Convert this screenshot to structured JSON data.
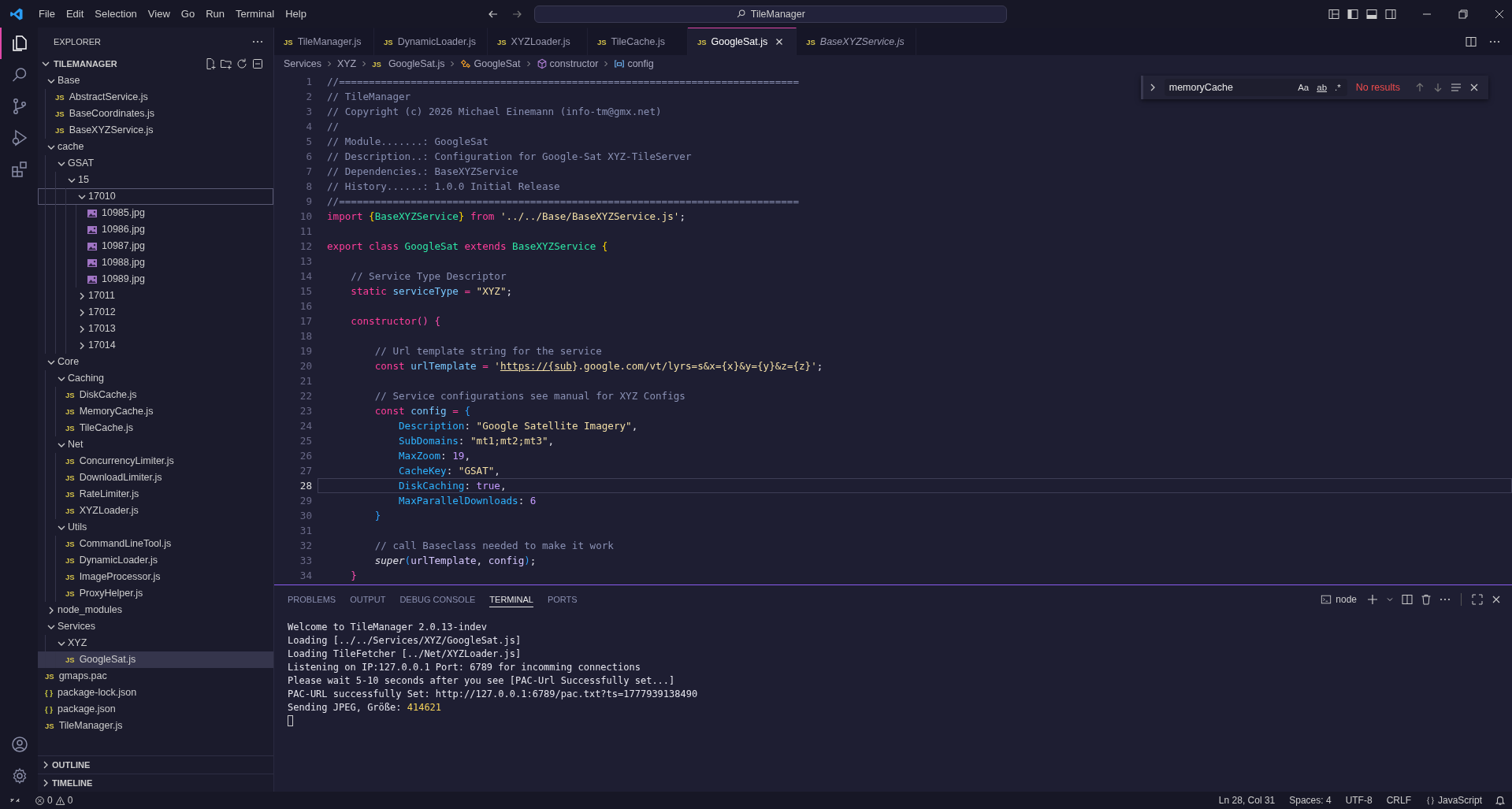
{
  "menu": [
    "File",
    "Edit",
    "Selection",
    "View",
    "Go",
    "Run",
    "Terminal",
    "Help"
  ],
  "command_center": {
    "text": "TileManager"
  },
  "explorer": {
    "title": "EXPLORER",
    "root": "TILEMANAGER",
    "tree": [
      {
        "label": "Base",
        "kind": "folder",
        "expanded": true,
        "selected": false,
        "focused": false,
        "children": [
          {
            "label": "AbstractService.js",
            "kind": "js",
            "badge": "JS",
            "selected": false,
            "focused": false
          },
          {
            "label": "BaseCoordinates.js",
            "kind": "js",
            "badge": "JS",
            "selected": false,
            "focused": false
          },
          {
            "label": "BaseXYZService.js",
            "kind": "js",
            "badge": "JS",
            "selected": false,
            "focused": false
          }
        ]
      },
      {
        "label": "cache",
        "kind": "folder",
        "expanded": true,
        "selected": false,
        "focused": false,
        "children": [
          {
            "label": "GSAT",
            "kind": "folder",
            "expanded": true,
            "selected": false,
            "focused": false,
            "children": [
              {
                "label": "15",
                "kind": "folder",
                "expanded": true,
                "selected": false,
                "focused": false,
                "children": [
                  {
                    "label": "17010",
                    "kind": "folder",
                    "expanded": true,
                    "selected": false,
                    "focused": true,
                    "children": [
                      {
                        "label": "10985.jpg",
                        "kind": "image",
                        "selected": false,
                        "focused": false
                      },
                      {
                        "label": "10986.jpg",
                        "kind": "image",
                        "selected": false,
                        "focused": false
                      },
                      {
                        "label": "10987.jpg",
                        "kind": "image",
                        "selected": false,
                        "focused": false
                      },
                      {
                        "label": "10988.jpg",
                        "kind": "image",
                        "selected": false,
                        "focused": false
                      },
                      {
                        "label": "10989.jpg",
                        "kind": "image",
                        "selected": false,
                        "focused": false
                      }
                    ]
                  },
                  {
                    "label": "17011",
                    "kind": "folder",
                    "expanded": false,
                    "selected": false,
                    "focused": false
                  },
                  {
                    "label": "17012",
                    "kind": "folder",
                    "expanded": false,
                    "selected": false,
                    "focused": false
                  },
                  {
                    "label": "17013",
                    "kind": "folder",
                    "expanded": false,
                    "selected": false,
                    "focused": false
                  },
                  {
                    "label": "17014",
                    "kind": "folder",
                    "expanded": false,
                    "selected": false,
                    "focused": false
                  }
                ]
              }
            ]
          }
        ]
      },
      {
        "label": "Core",
        "kind": "folder",
        "expanded": true,
        "selected": false,
        "focused": false,
        "children": [
          {
            "label": "Caching",
            "kind": "folder",
            "expanded": true,
            "selected": false,
            "focused": false,
            "children": [
              {
                "label": "DiskCache.js",
                "kind": "js",
                "badge": "JS",
                "selected": false,
                "focused": false
              },
              {
                "label": "MemoryCache.js",
                "kind": "js",
                "badge": "JS",
                "selected": false,
                "focused": false
              },
              {
                "label": "TileCache.js",
                "kind": "js",
                "badge": "JS",
                "selected": false,
                "focused": false
              }
            ]
          },
          {
            "label": "Net",
            "kind": "folder",
            "expanded": true,
            "selected": false,
            "focused": false,
            "children": [
              {
                "label": "ConcurrencyLimiter.js",
                "kind": "js",
                "badge": "JS",
                "selected": false,
                "focused": false
              },
              {
                "label": "DownloadLimiter.js",
                "kind": "js",
                "badge": "JS",
                "selected": false,
                "focused": false
              },
              {
                "label": "RateLimiter.js",
                "kind": "js",
                "badge": "JS",
                "selected": false,
                "focused": false
              },
              {
                "label": "XYZLoader.js",
                "kind": "js",
                "badge": "JS",
                "selected": false,
                "focused": false
              }
            ]
          },
          {
            "label": "Utils",
            "kind": "folder",
            "expanded": true,
            "selected": false,
            "focused": false,
            "children": [
              {
                "label": "CommandLineTool.js",
                "kind": "js",
                "badge": "JS",
                "selected": false,
                "focused": false
              },
              {
                "label": "DynamicLoader.js",
                "kind": "js",
                "badge": "JS",
                "selected": false,
                "focused": false
              },
              {
                "label": "ImageProcessor.js",
                "kind": "js",
                "badge": "JS",
                "selected": false,
                "focused": false
              },
              {
                "label": "ProxyHelper.js",
                "kind": "js",
                "badge": "JS",
                "selected": false,
                "focused": false
              }
            ]
          }
        ]
      },
      {
        "label": "node_modules",
        "kind": "folder",
        "expanded": false,
        "selected": false,
        "focused": false
      },
      {
        "label": "Services",
        "kind": "folder",
        "expanded": true,
        "selected": false,
        "focused": false,
        "children": [
          {
            "label": "XYZ",
            "kind": "folder",
            "expanded": true,
            "selected": false,
            "focused": false,
            "children": [
              {
                "label": "GoogleSat.js",
                "kind": "js",
                "badge": "JS",
                "selected": true,
                "focused": false
              }
            ]
          }
        ]
      },
      {
        "label": "gmaps.pac",
        "kind": "js",
        "badge": "JS",
        "selected": false,
        "focused": false
      },
      {
        "label": "package-lock.json",
        "kind": "json",
        "badge": "{ }",
        "selected": false,
        "focused": false
      },
      {
        "label": "package.json",
        "kind": "json",
        "badge": "{ }",
        "selected": false,
        "focused": false
      },
      {
        "label": "TileManager.js",
        "kind": "js",
        "badge": "JS",
        "selected": false,
        "focused": false
      }
    ],
    "sections": [
      "OUTLINE",
      "TIMELINE"
    ]
  },
  "tabs": [
    {
      "label": "TileManager.js",
      "badge": "JS",
      "selected": false,
      "preview": false
    },
    {
      "label": "DynamicLoader.js",
      "badge": "JS",
      "selected": false,
      "preview": false
    },
    {
      "label": "XYZLoader.js",
      "badge": "JS",
      "selected": false,
      "preview": false
    },
    {
      "label": "TileCache.js",
      "badge": "JS",
      "selected": false,
      "preview": false
    },
    {
      "label": "GoogleSat.js",
      "badge": "JS",
      "selected": true,
      "preview": false
    },
    {
      "label": "BaseXYZService.js",
      "badge": "JS",
      "selected": false,
      "preview": true
    }
  ],
  "breadcrumbs": [
    {
      "label": "Services",
      "kind": "folder"
    },
    {
      "label": "XYZ",
      "kind": "folder"
    },
    {
      "label": "GoogleSat.js",
      "kind": "file",
      "badge": "JS"
    },
    {
      "label": "GoogleSat",
      "kind": "class"
    },
    {
      "label": "constructor",
      "kind": "method"
    },
    {
      "label": "config",
      "kind": "variable"
    }
  ],
  "code": [
    {
      "number": "1",
      "current": false,
      "tokens": [
        {
          "kind": "comment",
          "text": "//============================================================================="
        }
      ]
    },
    {
      "number": "2",
      "current": false,
      "tokens": [
        {
          "kind": "comment",
          "text": "// TileManager"
        }
      ]
    },
    {
      "number": "3",
      "current": false,
      "tokens": [
        {
          "kind": "comment",
          "text": "// Copyright (c) 2026 Michael Einemann (info-tm@gmx.net)"
        }
      ]
    },
    {
      "number": "4",
      "current": false,
      "tokens": [
        {
          "kind": "comment",
          "text": "//"
        }
      ]
    },
    {
      "number": "5",
      "current": false,
      "tokens": [
        {
          "kind": "comment",
          "text": "// Module.......: GoogleSat"
        }
      ]
    },
    {
      "number": "6",
      "current": false,
      "tokens": [
        {
          "kind": "comment",
          "text": "// Description..: Configuration for Google-Sat XYZ-TileServer"
        }
      ]
    },
    {
      "number": "7",
      "current": false,
      "tokens": [
        {
          "kind": "comment",
          "text": "// Dependencies.: BaseXYZService"
        }
      ]
    },
    {
      "number": "8",
      "current": false,
      "tokens": [
        {
          "kind": "comment",
          "text": "// History......: 1.0.0 Initial Release"
        }
      ]
    },
    {
      "number": "9",
      "current": false,
      "tokens": [
        {
          "kind": "comment",
          "text": "//============================================================================="
        }
      ]
    },
    {
      "number": "10",
      "current": false,
      "tokens": [
        {
          "kind": "keyword",
          "text": "import"
        },
        {
          "kind": "bracket1",
          "text": " {"
        },
        {
          "kind": "type",
          "text": "BaseXYZService"
        },
        {
          "kind": "bracket1",
          "text": "}"
        },
        {
          "kind": "keyword",
          "text": " from"
        },
        {
          "kind": "string",
          "text": " '../../Base/BaseXYZService.js'"
        },
        {
          "kind": "plain",
          "text": ";"
        }
      ]
    },
    {
      "number": "11",
      "current": false
    },
    {
      "number": "12",
      "current": false,
      "tokens": [
        {
          "kind": "keyword",
          "text": "export class"
        },
        {
          "kind": "type",
          "text": " GoogleSat"
        },
        {
          "kind": "keyword",
          "text": " extends"
        },
        {
          "kind": "type",
          "text": " BaseXYZService"
        },
        {
          "kind": "bracket1",
          "text": " {"
        }
      ]
    },
    {
      "number": "13",
      "current": false
    },
    {
      "number": "14",
      "current": false,
      "tokens": [
        {
          "kind": "comment",
          "text": "    // Service Type Descriptor"
        }
      ]
    },
    {
      "number": "15",
      "current": false,
      "tokens": [
        {
          "kind": "keyword",
          "text": "    static"
        },
        {
          "kind": "variable",
          "text": " serviceType"
        },
        {
          "kind": "operator",
          "text": " = "
        },
        {
          "kind": "string",
          "text": "\"XYZ\""
        },
        {
          "kind": "plain",
          "text": ";"
        }
      ]
    },
    {
      "number": "16",
      "current": false
    },
    {
      "number": "17",
      "current": false,
      "tokens": [
        {
          "kind": "keyword",
          "text": "    constructor"
        },
        {
          "kind": "bracket2",
          "text": "() {"
        }
      ]
    },
    {
      "number": "18",
      "current": false
    },
    {
      "number": "19",
      "current": false,
      "tokens": [
        {
          "kind": "comment",
          "text": "        // Url template string for the service"
        }
      ]
    },
    {
      "number": "20",
      "current": false,
      "tokens": [
        {
          "kind": "keyword",
          "text": "        const"
        },
        {
          "kind": "variable",
          "text": " urlTemplate"
        },
        {
          "kind": "operator",
          "text": " = "
        },
        {
          "kind": "string",
          "text": "'"
        },
        {
          "kind": "link",
          "text": "https://{sub"
        },
        {
          "kind": "string",
          "text": "}.google.com/vt/lyrs=s&x={x}&y={y}&z={z}'"
        },
        {
          "kind": "plain",
          "text": ";"
        }
      ]
    },
    {
      "number": "21",
      "current": false
    },
    {
      "number": "22",
      "current": false,
      "tokens": [
        {
          "kind": "comment",
          "text": "        // Service configurations see manual for XYZ Configs"
        }
      ]
    },
    {
      "number": "23",
      "current": false,
      "tokens": [
        {
          "kind": "keyword",
          "text": "        const"
        },
        {
          "kind": "variable",
          "text": " config"
        },
        {
          "kind": "operator",
          "text": " = "
        },
        {
          "kind": "bracket3",
          "text": "{"
        }
      ]
    },
    {
      "number": "24",
      "current": false,
      "tokens": [
        {
          "kind": "property",
          "text": "            Description"
        },
        {
          "kind": "plain",
          "text": ": "
        },
        {
          "kind": "string",
          "text": "\"Google Satellite Imagery\""
        },
        {
          "kind": "plain",
          "text": ","
        }
      ]
    },
    {
      "number": "25",
      "current": false,
      "tokens": [
        {
          "kind": "property",
          "text": "            SubDomains"
        },
        {
          "kind": "plain",
          "text": ": "
        },
        {
          "kind": "string",
          "text": "\"mt1;mt2;mt3\""
        },
        {
          "kind": "plain",
          "text": ","
        }
      ]
    },
    {
      "number": "26",
      "current": false,
      "tokens": [
        {
          "kind": "property",
          "text": "            MaxZoom"
        },
        {
          "kind": "plain",
          "text": ": "
        },
        {
          "kind": "number",
          "text": "19"
        },
        {
          "kind": "plain",
          "text": ","
        }
      ]
    },
    {
      "number": "27",
      "current": false,
      "tokens": [
        {
          "kind": "property",
          "text": "            CacheKey"
        },
        {
          "kind": "plain",
          "text": ": "
        },
        {
          "kind": "string",
          "text": "\"GSAT\""
        },
        {
          "kind": "plain",
          "text": ","
        }
      ]
    },
    {
      "number": "28",
      "current": true,
      "tokens": [
        {
          "kind": "property",
          "text": "            DiskCaching"
        },
        {
          "kind": "plain",
          "text": ": "
        },
        {
          "kind": "number",
          "text": "true"
        },
        {
          "kind": "plain",
          "text": ","
        }
      ]
    },
    {
      "number": "29",
      "current": false,
      "tokens": [
        {
          "kind": "property",
          "text": "            MaxParallelDownloads"
        },
        {
          "kind": "plain",
          "text": ": "
        },
        {
          "kind": "number",
          "text": "6"
        }
      ]
    },
    {
      "number": "30",
      "current": false,
      "tokens": [
        {
          "kind": "bracket3",
          "text": "        }"
        }
      ]
    },
    {
      "number": "31",
      "current": false
    },
    {
      "number": "32",
      "current": false,
      "tokens": [
        {
          "kind": "comment",
          "text": "        // call Baseclass needed to make it work"
        }
      ]
    },
    {
      "number": "33",
      "current": false,
      "tokens": [
        {
          "kind": "function",
          "text": "        super"
        },
        {
          "kind": "bracket3",
          "text": "("
        },
        {
          "kind": "argument",
          "text": "urlTemplate"
        },
        {
          "kind": "plain",
          "text": ", "
        },
        {
          "kind": "argument",
          "text": "config"
        },
        {
          "kind": "bracket3",
          "text": ")"
        },
        {
          "kind": "plain",
          "text": ";"
        }
      ]
    },
    {
      "number": "34",
      "current": false,
      "tokens": [
        {
          "kind": "bracket2",
          "text": "    }"
        }
      ]
    }
  ],
  "find": {
    "value": "memoryCache",
    "options": [
      {
        "label": "Aa",
        "on": false
      },
      {
        "label": "ab",
        "on": false
      },
      {
        "label": ".*",
        "on": false
      }
    ],
    "result": "No results"
  },
  "panel": {
    "tabs": [
      {
        "label": "PROBLEMS",
        "selected": false
      },
      {
        "label": "OUTPUT",
        "selected": false
      },
      {
        "label": "DEBUG CONSOLE",
        "selected": false
      },
      {
        "label": "TERMINAL",
        "selected": true
      },
      {
        "label": "PORTS",
        "selected": false
      }
    ],
    "terminal_name": "node",
    "lines": [
      [
        {
          "kind": "plain",
          "text": "Welcome to TileManager 2.0.13-indev"
        }
      ],
      [
        {
          "kind": "plain",
          "text": "Loading [../../Services/XYZ/GoogleSat.js]"
        }
      ],
      [
        {
          "kind": "plain",
          "text": "Loading TileFetcher [../Net/XYZLoader.js]"
        }
      ],
      [
        {
          "kind": "plain",
          "text": "Listening on IP:127.0.0.1 Port: 6789 for incomming connections"
        }
      ],
      [
        {
          "kind": "plain",
          "text": "Please wait 5-10 seconds after you see [PAC-Url Successfully set...]"
        }
      ],
      [
        {
          "kind": "plain",
          "text": "PAC-URL successfully Set: http://127.0.0.1:6789/pac.txt?ts=1777939138490"
        }
      ],
      [
        {
          "kind": "plain",
          "text": "Sending JPEG, Größe: "
        },
        {
          "kind": "number",
          "text": "414621"
        }
      ]
    ]
  },
  "status_bar": {
    "errors": "0",
    "warnings": "0",
    "items": [
      "Ln 28, Col 31",
      "Spaces: 4",
      "UTF-8",
      "CRLF"
    ],
    "language": "JavaScript"
  }
}
